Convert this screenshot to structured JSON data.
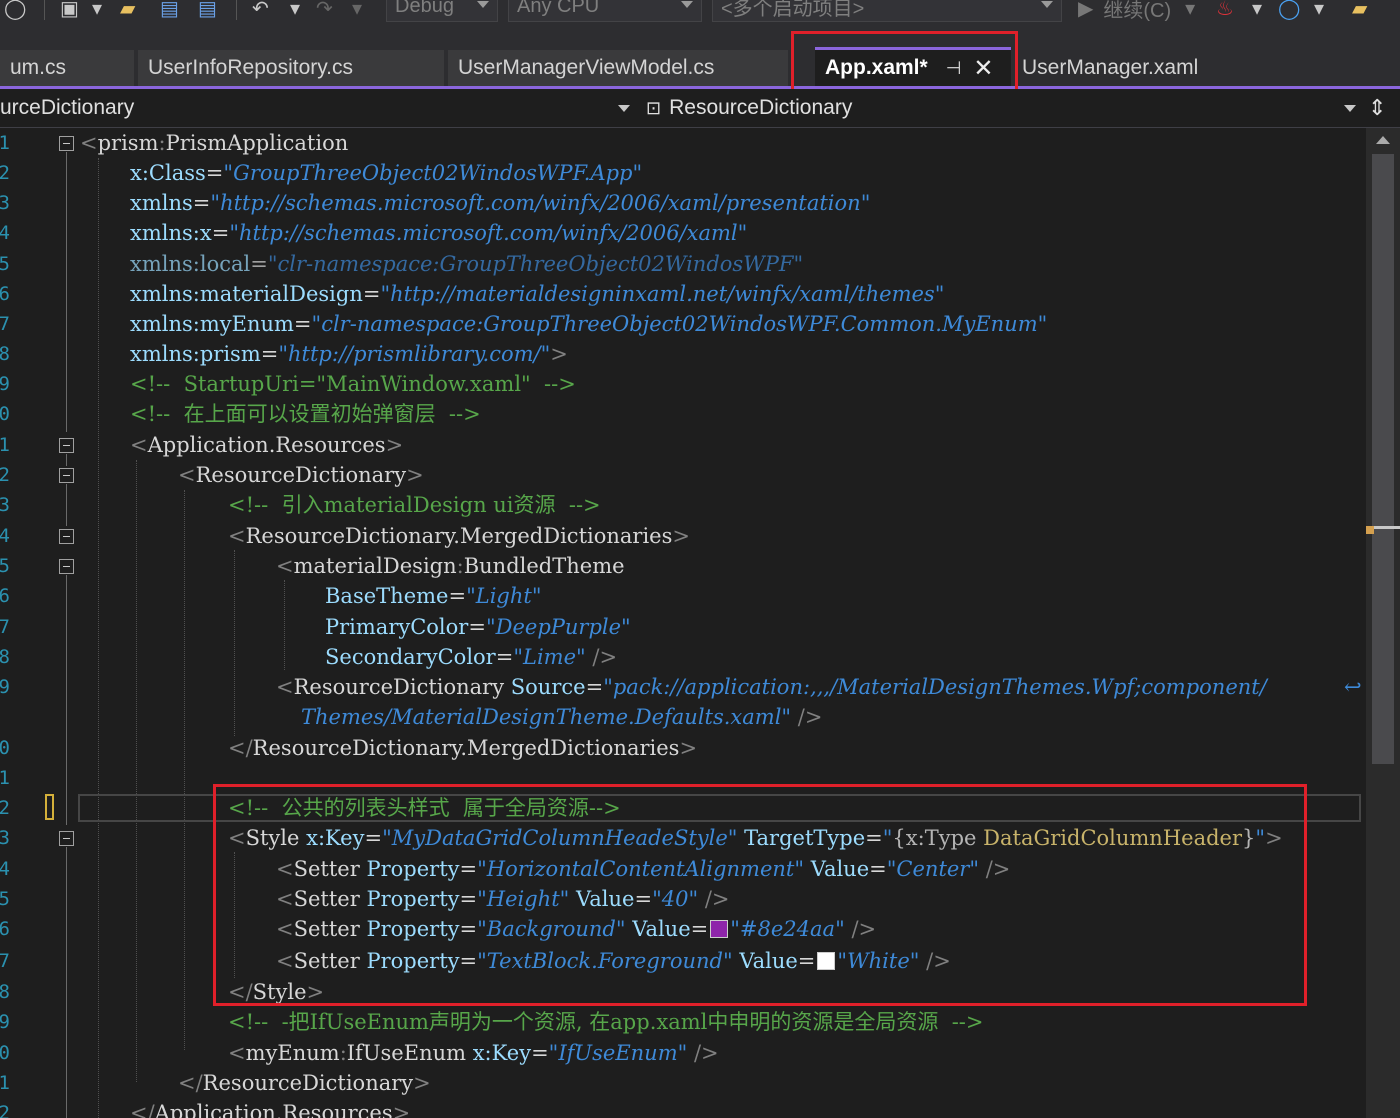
{
  "toolbar": {
    "config": "Debug",
    "platform": "Any CPU",
    "startup": "<多个启动项目>",
    "continue_label": "继续(C)"
  },
  "tabs": [
    {
      "label": "um.cs",
      "active": false
    },
    {
      "label": "UserInfoRepository.cs",
      "active": false
    },
    {
      "label": "UserManagerViewModel.cs",
      "active": false
    },
    {
      "label": "App.xaml*",
      "active": true
    },
    {
      "label": "UserManager.xaml",
      "active": false
    }
  ],
  "nav": {
    "left": "urceDictionary",
    "right": "ResourceDictionary"
  },
  "line_numbers": [
    "1",
    "2",
    "3",
    "4",
    "5",
    "6",
    "7",
    "8",
    "9",
    "0",
    "1",
    "2",
    "3",
    "4",
    "5",
    "6",
    "7",
    "8",
    "9",
    "",
    "0",
    "1",
    "2",
    "3",
    "4",
    "5",
    "6",
    "7",
    "8",
    "9",
    "0",
    "1",
    "2"
  ],
  "colors": {
    "accent": "#8b66dd",
    "highlight_box": "#e0202a",
    "swatch_background": "#8e24aa",
    "swatch_foreground": "#ffffff"
  },
  "code": {
    "l1": {
      "tag": "prism",
      "name": "PrismApplication"
    },
    "l2": {
      "attr": "x:Class",
      "val": "GroupThreeObject02WindosWPF.App"
    },
    "l3": {
      "attr": "xmlns",
      "val": "http://schemas.microsoft.com/winfx/2006/xaml/presentation"
    },
    "l4": {
      "attr": "xmlns:x",
      "val": "http://schemas.microsoft.com/winfx/2006/xaml"
    },
    "l5": {
      "attr": "xmlns:local",
      "val": "clr-namespace:GroupThreeObject02WindosWPF"
    },
    "l6": {
      "attr": "xmlns:materialDesign",
      "val": "http://materialdesigninxaml.net/winfx/xaml/themes"
    },
    "l7": {
      "attr": "xmlns:myEnum",
      "val": "clr-namespace:GroupThreeObject02WindosWPF.Common.MyEnum"
    },
    "l8": {
      "attr": "xmlns:prism",
      "val": "http://prismlibrary.com/"
    },
    "l9": {
      "comment": "<!--  StartupUri=\"MainWindow.xaml\"  -->"
    },
    "l10": {
      "comment": "<!--  在上面可以设置初始弹窗层  -->"
    },
    "l11": {
      "tag": "Application.Resources"
    },
    "l12": {
      "tag": "ResourceDictionary"
    },
    "l13": {
      "comment": "<!--  引入materialDesign ui资源  -->"
    },
    "l14": {
      "tag": "ResourceDictionary.MergedDictionaries"
    },
    "l15": {
      "prefix": "materialDesign",
      "tag": "BundledTheme"
    },
    "l16": {
      "attr": "BaseTheme",
      "val": "Light"
    },
    "l17": {
      "attr": "PrimaryColor",
      "val": "DeepPurple"
    },
    "l18": {
      "attr": "SecondaryColor",
      "val": "Lime"
    },
    "l19": {
      "tag": "ResourceDictionary",
      "attr": "Source",
      "val": "pack://application:,,,/MaterialDesignThemes.Wpf;component/"
    },
    "l19b": {
      "val": "Themes/MaterialDesignTheme.Defaults.xaml"
    },
    "l20": {
      "tag": "ResourceDictionary.MergedDictionaries"
    },
    "l22": {
      "comment": "<!--  公共的列表头样式  属于全局资源-->"
    },
    "l23": {
      "tag": "Style",
      "attr1": "x:Key",
      "val1": "MyDataGridColumnHeadeStyle",
      "attr2": "TargetType",
      "val2a": "{",
      "val2b": "x:Type",
      "val2c": "DataGridColumnHeader",
      "val2d": "}"
    },
    "l24": {
      "tag": "Setter",
      "attr1": "Property",
      "val1": "HorizontalContentAlignment",
      "attr2": "Value",
      "val2": "Center"
    },
    "l25": {
      "tag": "Setter",
      "attr1": "Property",
      "val1": "Height",
      "attr2": "Value",
      "val2": "40"
    },
    "l26": {
      "tag": "Setter",
      "attr1": "Property",
      "val1": "Background",
      "attr2": "Value",
      "val2": "#8e24aa"
    },
    "l27": {
      "tag": "Setter",
      "attr1": "Property",
      "val1": "TextBlock.Foreground",
      "attr2": "Value",
      "val2": "White"
    },
    "l28": {
      "tag": "Style"
    },
    "l29": {
      "comment": "<!--  -把IfUseEnum声明为一个资源, 在app.xaml中申明的资源是全局资源  -->"
    },
    "l30": {
      "prefix": "myEnum",
      "tag": "IfUseEnum",
      "attr": "x:Key",
      "val": "IfUseEnum"
    },
    "l31": {
      "tag": "ResourceDictionary"
    },
    "l32": {
      "tag": "Application.Resources"
    }
  }
}
